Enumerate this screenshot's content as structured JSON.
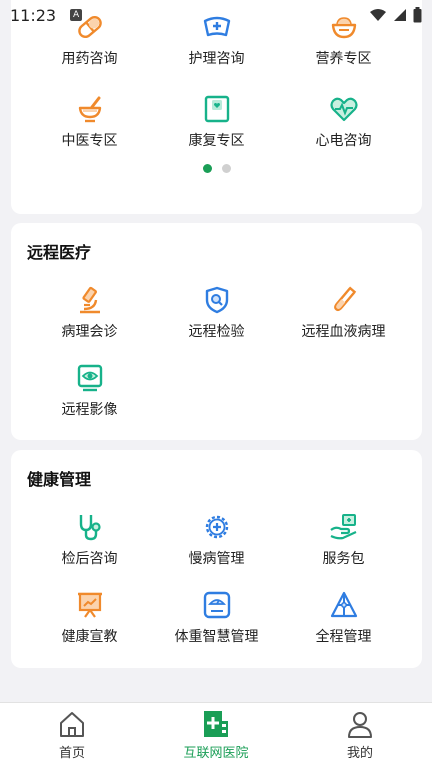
{
  "status_bar": {
    "time": "11:23",
    "notification_letter": "A"
  },
  "consult_grid": [
    {
      "label": "用药咨询",
      "icon": "pill-icon"
    },
    {
      "label": "护理咨询",
      "icon": "nurse-cap-icon"
    },
    {
      "label": "营养专区",
      "icon": "bowl-icon"
    },
    {
      "label": "中医专区",
      "icon": "mortar-icon"
    },
    {
      "label": "康复专区",
      "icon": "rehab-card-icon"
    },
    {
      "label": "心电咨询",
      "icon": "heartbeat-icon"
    }
  ],
  "carousel": {
    "pages": 2,
    "active_index": 0
  },
  "remote": {
    "title": "远程医疗",
    "items": [
      {
        "label": "病理会诊",
        "icon": "microscope-icon"
      },
      {
        "label": "远程检验",
        "icon": "shield-search-icon"
      },
      {
        "label": "远程血液病理",
        "icon": "test-tube-icon"
      },
      {
        "label": "远程影像",
        "icon": "monitor-eye-icon"
      }
    ]
  },
  "health": {
    "title": "健康管理",
    "items": [
      {
        "label": "检后咨询",
        "icon": "stethoscope-icon"
      },
      {
        "label": "慢病管理",
        "icon": "gear-cross-icon"
      },
      {
        "label": "服务包",
        "icon": "hand-package-icon"
      },
      {
        "label": "健康宣教",
        "icon": "presentation-board-icon"
      },
      {
        "label": "体重智慧管理",
        "icon": "scale-icon"
      },
      {
        "label": "全程管理",
        "icon": "triangle-nodes-icon"
      }
    ]
  },
  "tabbar": [
    {
      "label": "首页",
      "icon": "home-icon",
      "active": false
    },
    {
      "label": "互联网医院",
      "icon": "hospital-icon",
      "active": true
    },
    {
      "label": "我的",
      "icon": "person-icon",
      "active": false
    }
  ],
  "colors": {
    "accent_green": "#1a9e56",
    "orange": "#f08a2c",
    "blue": "#2f7de1",
    "teal": "#17b28a"
  }
}
